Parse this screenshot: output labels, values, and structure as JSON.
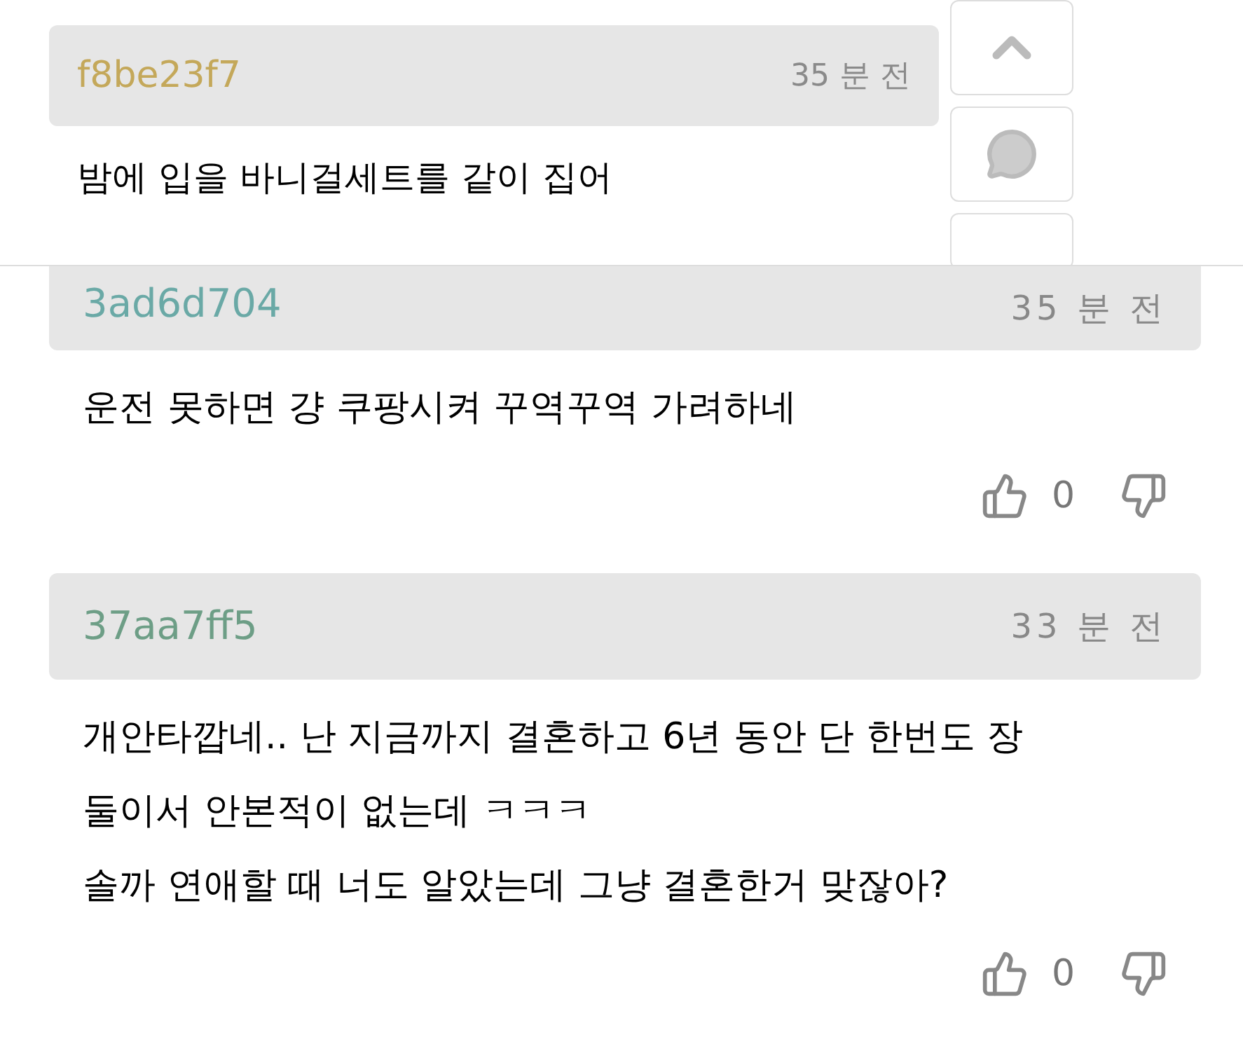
{
  "top_comment": {
    "name": "f8be23f7",
    "color": "#c4a85a",
    "time": "35 분 전",
    "lines": [
      "밤에 입을 바니걸세트를 같이 집어"
    ]
  },
  "comments": [
    {
      "name": "3ad6d704",
      "color": "#6aa9a6",
      "time": "35 분 전",
      "header_cut": true,
      "lines": [
        "운전 못하면 걍 쿠팡시켜 꾸역꾸역 가려하네"
      ],
      "likes": "0"
    },
    {
      "name": "37aa7ff5",
      "color": "#6d9e86",
      "time": "33 분 전",
      "header_cut": false,
      "lines": [
        "개안타깝네.. 난 지금까지 결혼하고 6년 동안 단 한번도 장",
        "둘이서 안본적이 없는데 ㅋㅋㅋ",
        "솔까 연애할 때 너도 알았는데 그냥 결혼한거 맞잖아?"
      ],
      "likes": "0"
    }
  ]
}
